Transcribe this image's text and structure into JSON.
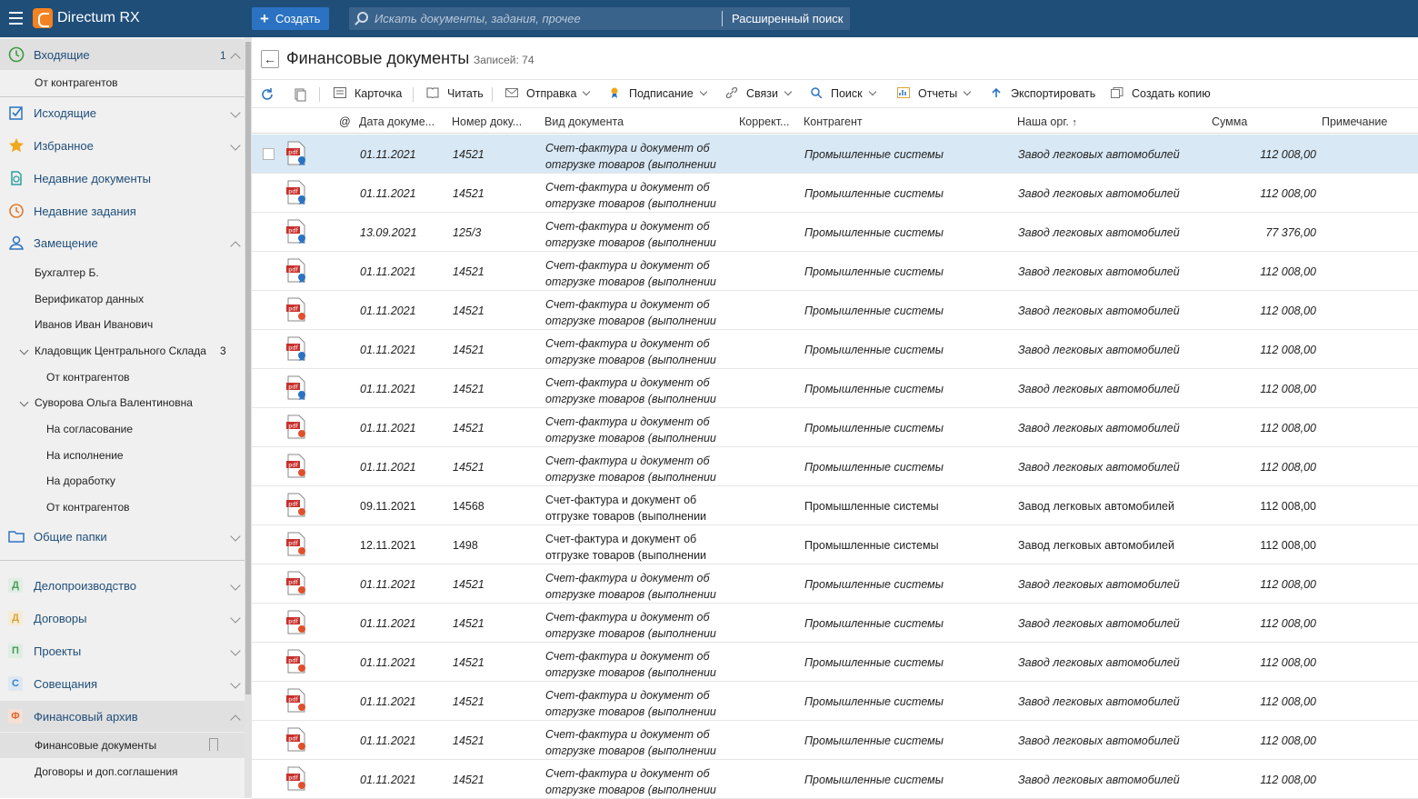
{
  "app": {
    "title": "Directum RX"
  },
  "header": {
    "create_label": "Создать",
    "search_placeholder": "Искать документы, задания, прочее",
    "advanced_search_label": "Расширенный поиск"
  },
  "sidebar": {
    "incoming": {
      "label": "Входящие",
      "count": "1",
      "sub": "От контрагентов"
    },
    "outgoing": "Исходящие",
    "favorites": "Избранное",
    "recent_docs": "Недавние документы",
    "recent_tasks": "Недавние задания",
    "substitution": {
      "label": "Замещение",
      "items": [
        "Бухгалтер Б.",
        "Верификатор данных",
        "Иванов Иван Иванович"
      ],
      "storekeeper": {
        "label": "Кладовщик Центрального Склада",
        "count": "3",
        "sub": "От контрагентов"
      },
      "suvorova": {
        "label": "Суворова Ольга Валентиновна",
        "items": [
          "На согласование",
          "На исполнение",
          "На доработку",
          "От контрагентов"
        ]
      }
    },
    "shared_folders": "Общие папки",
    "modules": [
      {
        "letter": "Д",
        "label": "Делопроизводство",
        "color": "#4a9a5e"
      },
      {
        "letter": "Д",
        "label": "Договоры",
        "color": "#d9a43a"
      },
      {
        "letter": "П",
        "label": "Проекты",
        "color": "#4a9a5e"
      },
      {
        "letter": "С",
        "label": "Совещания",
        "color": "#3a7fc1"
      },
      {
        "letter": "Ф",
        "label": "Финансовый архив",
        "color": "#e0662c"
      }
    ],
    "finance_items": [
      "Финансовые документы",
      "Договоры и доп.соглашения"
    ]
  },
  "main": {
    "title": "Финансовые документы",
    "records": "Записей: 74",
    "toolbar": {
      "card": "Карточка",
      "read": "Читать",
      "send": "Отправка",
      "sign": "Подписание",
      "links": "Связи",
      "search": "Поиск",
      "reports": "Отчеты",
      "export": "Экспортировать",
      "copy": "Создать копию"
    },
    "columns": {
      "at": "@",
      "date": "Дата докуме...",
      "number": "Номер доку...",
      "kind": "Вид документа",
      "correction": "Коррект...",
      "counterparty": "Контрагент",
      "our_org": "Наша орг.",
      "sum": "Сумма",
      "note": "Примечание"
    },
    "rows": [
      {
        "date": "01.11.2021",
        "number": "14521",
        "kind1": "Счет-фактура и документ об",
        "kind2": "отгрузке товаров (выполнении",
        "cp": "Промышленные системы",
        "org": "Завод легковых автомобилей",
        "sum": "112 008,00",
        "italic": true,
        "badge": "blue"
      },
      {
        "date": "01.11.2021",
        "number": "14521",
        "kind1": "Счет-фактура и документ об",
        "kind2": "отгрузке товаров (выполнении",
        "cp": "Промышленные системы",
        "org": "Завод легковых автомобилей",
        "sum": "112 008,00",
        "italic": true,
        "badge": "blue"
      },
      {
        "date": "13.09.2021",
        "number": "125/3",
        "kind1": "Счет-фактура и документ об",
        "kind2": "отгрузке товаров (выполнении",
        "cp": "Промышленные системы",
        "org": "Завод легковых автомобилей",
        "sum": "77 376,00",
        "italic": true,
        "badge": "blue"
      },
      {
        "date": "01.11.2021",
        "number": "14521",
        "kind1": "Счет-фактура и документ об",
        "kind2": "отгрузке товаров (выполнении",
        "cp": "Промышленные системы",
        "org": "Завод легковых автомобилей",
        "sum": "112 008,00",
        "italic": true,
        "badge": "blue"
      },
      {
        "date": "01.11.2021",
        "number": "14521",
        "kind1": "Счет-фактура и документ об",
        "kind2": "отгрузке товаров (выполнении",
        "cp": "Промышленные системы",
        "org": "Завод легковых автомобилей",
        "sum": "112 008,00",
        "italic": true,
        "badge": "red"
      },
      {
        "date": "01.11.2021",
        "number": "14521",
        "kind1": "Счет-фактура и документ об",
        "kind2": "отгрузке товаров (выполнении",
        "cp": "Промышленные системы",
        "org": "Завод легковых автомобилей",
        "sum": "112 008,00",
        "italic": true,
        "badge": "blue"
      },
      {
        "date": "01.11.2021",
        "number": "14521",
        "kind1": "Счет-фактура и документ об",
        "kind2": "отгрузке товаров (выполнении",
        "cp": "Промышленные системы",
        "org": "Завод легковых автомобилей",
        "sum": "112 008,00",
        "italic": true,
        "badge": "blue"
      },
      {
        "date": "01.11.2021",
        "number": "14521",
        "kind1": "Счет-фактура и документ об",
        "kind2": "отгрузке товаров (выполнении",
        "cp": "Промышленные системы",
        "org": "Завод легковых автомобилей",
        "sum": "112 008,00",
        "italic": true,
        "badge": "red"
      },
      {
        "date": "01.11.2021",
        "number": "14521",
        "kind1": "Счет-фактура и документ об",
        "kind2": "отгрузке товаров (выполнении",
        "cp": "Промышленные системы",
        "org": "Завод легковых автомобилей",
        "sum": "112 008,00",
        "italic": true,
        "badge": "red"
      },
      {
        "date": "09.11.2021",
        "number": "14568",
        "kind1": "Счет-фактура и документ об",
        "kind2": "отгрузке товаров (выполнении",
        "cp": "Промышленные системы",
        "org": "Завод легковых автомобилей",
        "sum": "112 008,00",
        "italic": false,
        "badge": "red"
      },
      {
        "date": "12.11.2021",
        "number": "1498",
        "kind1": "Счет-фактура и документ об",
        "kind2": "отгрузке товаров (выполнении",
        "cp": "Промышленные системы",
        "org": "Завод легковых автомобилей",
        "sum": "112 008,00",
        "italic": false,
        "badge": "red"
      },
      {
        "date": "01.11.2021",
        "number": "14521",
        "kind1": "Счет-фактура и документ об",
        "kind2": "отгрузке товаров (выполнении",
        "cp": "Промышленные системы",
        "org": "Завод легковых автомобилей",
        "sum": "112 008,00",
        "italic": true,
        "badge": "red"
      },
      {
        "date": "01.11.2021",
        "number": "14521",
        "kind1": "Счет-фактура и документ об",
        "kind2": "отгрузке товаров (выполнении",
        "cp": "Промышленные системы",
        "org": "Завод легковых автомобилей",
        "sum": "112 008,00",
        "italic": true,
        "badge": "red"
      },
      {
        "date": "01.11.2021",
        "number": "14521",
        "kind1": "Счет-фактура и документ об",
        "kind2": "отгрузке товаров (выполнении",
        "cp": "Промышленные системы",
        "org": "Завод легковых автомобилей",
        "sum": "112 008,00",
        "italic": true,
        "badge": "red"
      },
      {
        "date": "01.11.2021",
        "number": "14521",
        "kind1": "Счет-фактура и документ об",
        "kind2": "отгрузке товаров (выполнении",
        "cp": "Промышленные системы",
        "org": "Завод легковых автомобилей",
        "sum": "112 008,00",
        "italic": true,
        "badge": "red"
      },
      {
        "date": "01.11.2021",
        "number": "14521",
        "kind1": "Счет-фактура и документ об",
        "kind2": "отгрузке товаров (выполнении",
        "cp": "Промышленные системы",
        "org": "Завод легковых автомобилей",
        "sum": "112 008,00",
        "italic": true,
        "badge": "red"
      },
      {
        "date": "01.11.2021",
        "number": "14521",
        "kind1": "Счет-фактура и документ об",
        "kind2": "отгрузке товаров (выполнении",
        "cp": "Промышленные системы",
        "org": "Завод легковых автомобилей",
        "sum": "112 008,00",
        "italic": true,
        "badge": "red"
      }
    ]
  },
  "colors": {
    "header_bg": "#1f4e79",
    "accent": "#2b73c2",
    "logo": "#f58220",
    "selected_row": "#d8e8f5",
    "badge_blue": "#2b73c2",
    "badge_red": "#e0502c",
    "pdf_red": "#c8302c"
  }
}
